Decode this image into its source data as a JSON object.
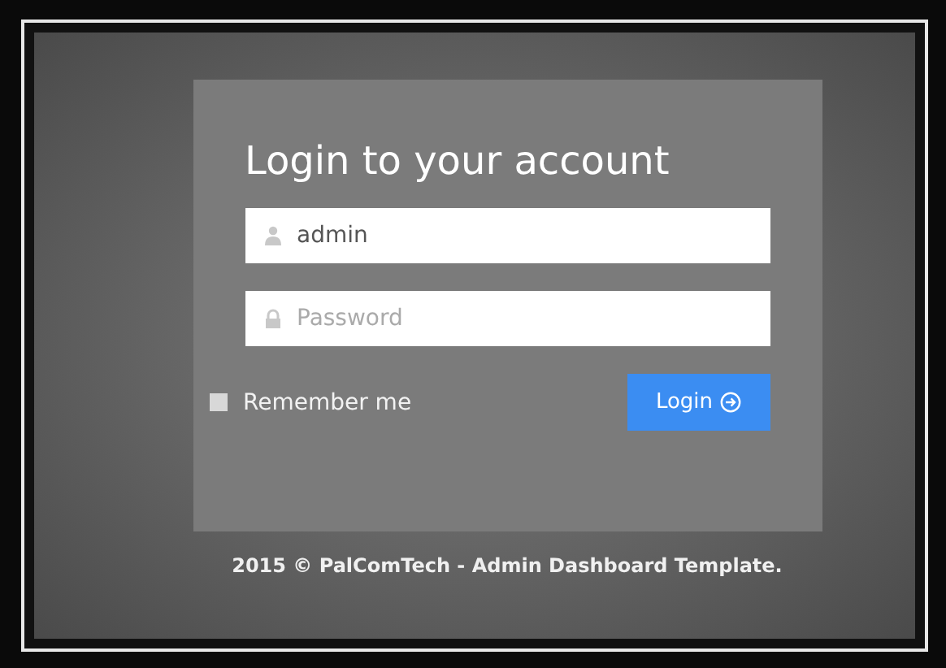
{
  "login": {
    "title": "Login to your account",
    "username": {
      "value": "admin"
    },
    "password": {
      "placeholder": "Password"
    },
    "remember": {
      "label": "Remember me",
      "checked": false
    },
    "submit": {
      "label": "Login"
    }
  },
  "footer": {
    "text": "2015 © PalComTech - Admin Dashboard Template."
  }
}
